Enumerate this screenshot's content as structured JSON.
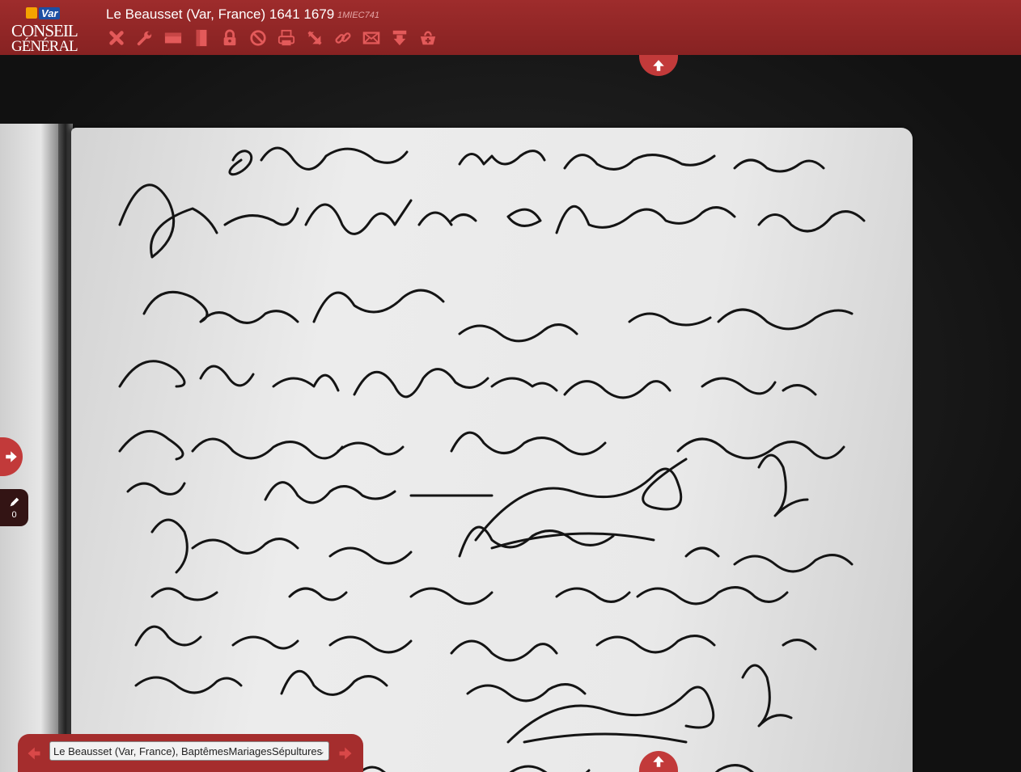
{
  "header": {
    "logo": {
      "var": "Var",
      "line1": "CONSEIL",
      "line2": "GÉNÉRAL"
    },
    "title": "Le Beausset (Var, France) 1641 1679",
    "cote": "1MIEC741",
    "tools": [
      {
        "name": "close-icon"
      },
      {
        "name": "wrench-icon"
      },
      {
        "name": "landscape-view-icon"
      },
      {
        "name": "portrait-view-icon"
      },
      {
        "name": "lock-icon"
      },
      {
        "name": "block-icon"
      },
      {
        "name": "print-icon"
      },
      {
        "name": "resize-icon"
      },
      {
        "name": "link-icon"
      },
      {
        "name": "mail-icon"
      },
      {
        "name": "download-icon"
      },
      {
        "name": "basket-icon"
      }
    ]
  },
  "annotations": {
    "count": "0"
  },
  "footer": {
    "selector_value": "Le Beausset (Var, France), BaptêmesMariagesSépultures"
  },
  "colors": {
    "bar": "#9e2c2c",
    "button": "#c23a3a",
    "ink": "#141414"
  }
}
